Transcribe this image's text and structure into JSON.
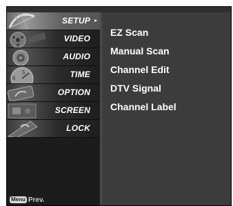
{
  "sidebar": {
    "items": [
      {
        "label": "SETUP",
        "icon": "satellite-dish-icon",
        "active": true
      },
      {
        "label": "VIDEO",
        "icon": "film-reel-icon",
        "active": false
      },
      {
        "label": "AUDIO",
        "icon": "speaker-icon",
        "active": false
      },
      {
        "label": "TIME",
        "icon": "clock-icon",
        "active": false
      },
      {
        "label": "OPTION",
        "icon": "option-sign-icon",
        "active": false
      },
      {
        "label": "SCREEN",
        "icon": "screen-icon",
        "active": false
      },
      {
        "label": "LOCK",
        "icon": "lock-icon",
        "active": false
      }
    ],
    "active_arrow": "▸"
  },
  "submenu": {
    "items": [
      "EZ Scan",
      "Manual Scan",
      "Channel Edit",
      "DTV Signal",
      "Channel Label"
    ]
  },
  "footer": {
    "key": "Menu",
    "label": "Prev."
  },
  "colors": {
    "background": "#1a1a1a",
    "submenu_bg": "#3c3c3c",
    "text": "#ffffff"
  }
}
